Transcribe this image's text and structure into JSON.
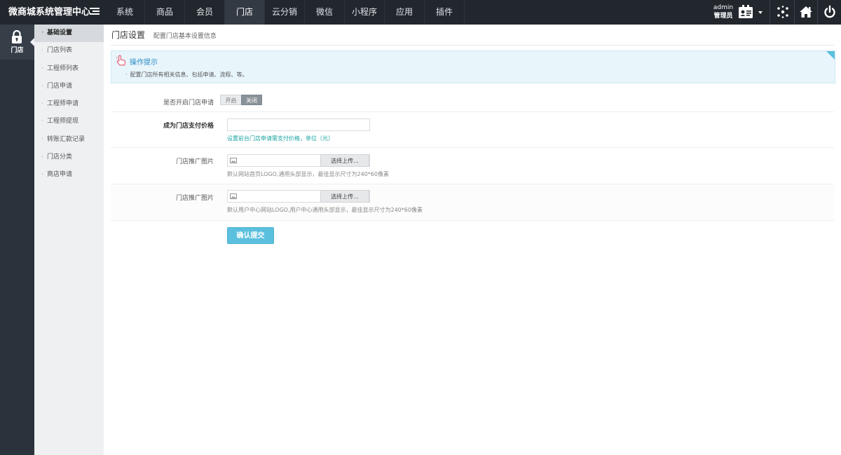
{
  "app": {
    "brand": "微商城系统管理中心"
  },
  "topnav": [
    {
      "label": "系统",
      "active": false
    },
    {
      "label": "商品",
      "active": false
    },
    {
      "label": "会员",
      "active": false
    },
    {
      "label": "门店",
      "active": true
    },
    {
      "label": "云分销",
      "active": false
    },
    {
      "label": "微信",
      "active": false
    },
    {
      "label": "小程序",
      "active": false
    },
    {
      "label": "应用",
      "active": false
    },
    {
      "label": "插件",
      "active": false
    }
  ],
  "user": {
    "name": "admin",
    "role": "管理员"
  },
  "module": {
    "label": "门店"
  },
  "sidebar": {
    "items": [
      {
        "label": "基础设置",
        "active": true
      },
      {
        "label": "门店列表",
        "active": false
      },
      {
        "label": "工程师列表",
        "active": false
      },
      {
        "label": "门店申请",
        "active": false
      },
      {
        "label": "工程师申请",
        "active": false
      },
      {
        "label": "工程师提现",
        "active": false
      },
      {
        "label": "转账汇款记录",
        "active": false
      },
      {
        "label": "门店分类",
        "active": false
      },
      {
        "label": "商店申请",
        "active": false
      }
    ]
  },
  "page": {
    "title": "门店设置",
    "subtitle": "配置门店基本设置信息"
  },
  "tips": {
    "title": "操作提示",
    "text": "配置门店所有相关信息、包括申请、流程、等。"
  },
  "form": {
    "apply_switch": {
      "label": "是否开启门店申请",
      "on_label": "开启",
      "off_label": "关闭",
      "value": "关闭"
    },
    "price": {
      "label": "成为门店支付价格",
      "value": "",
      "hint": "设置前台门店申请需支付价格，单位（元）"
    },
    "promo_image_1": {
      "label": "门店推广图片",
      "button": "选择上传...",
      "hint": "默认网站首页LOGO,通用头部显示，最佳显示尺寸为240*60像素"
    },
    "promo_image_2": {
      "label": "门店推广图片",
      "button": "选择上传...",
      "hint": "默认用户中心网站LOGO,用户中心通用头部显示，最佳显示尺寸为240*60像素"
    },
    "submit_label": "确认提交"
  },
  "colors": {
    "topbar": "#22272e",
    "sidebar_dark": "#2b323b",
    "sidebar_sub": "#eef0f2",
    "accent": "#5bc0de",
    "hint_green": "#1aa3a3"
  }
}
